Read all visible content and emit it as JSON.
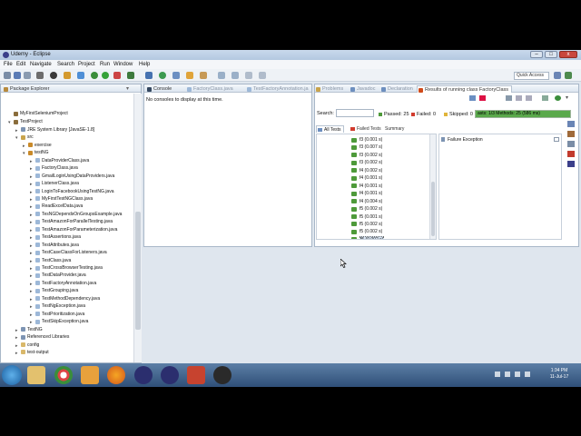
{
  "window": {
    "title": "Udemy - Eclipse",
    "minimize": "–",
    "maximize": "□",
    "close": "x"
  },
  "menu": [
    "File",
    "Edit",
    "Navigate",
    "Search",
    "Project",
    "Run",
    "Window",
    "Help"
  ],
  "quick_access": {
    "placeholder": "Quick Access"
  },
  "package_explorer": {
    "tab": "Package Explorer",
    "items": [
      {
        "label": "MyFirstSeleniumProject",
        "level": 0,
        "icon": "project-icon",
        "expand": ""
      },
      {
        "label": "TestProject",
        "level": 0,
        "icon": "project-icon",
        "expand": "▾"
      },
      {
        "label": "JRE System Library [JavaSE-1.8]",
        "level": 1,
        "icon": "library-icon",
        "expand": "▸"
      },
      {
        "label": "src",
        "level": 1,
        "icon": "source-folder-icon",
        "expand": "▾"
      },
      {
        "label": "exercise",
        "level": 2,
        "icon": "package-icon",
        "expand": "▸"
      },
      {
        "label": "testNG",
        "level": 2,
        "icon": "package-icon",
        "expand": "▾"
      },
      {
        "label": "DataProviderClass.java",
        "level": 3,
        "icon": "java-file-icon",
        "expand": "▸"
      },
      {
        "label": "FactoryClass.java",
        "level": 3,
        "icon": "java-file-icon",
        "expand": "▸"
      },
      {
        "label": "GmailLoginUsingDataProviders.java",
        "level": 3,
        "icon": "java-file-icon",
        "expand": "▸"
      },
      {
        "label": "ListenerClass.java",
        "level": 3,
        "icon": "java-file-icon",
        "expand": "▸"
      },
      {
        "label": "LoginToFacebookUsingTestNG.java",
        "level": 3,
        "icon": "java-file-icon",
        "expand": "▸"
      },
      {
        "label": "MyFirstTestNGClass.java",
        "level": 3,
        "icon": "java-file-icon",
        "expand": "▸"
      },
      {
        "label": "ReadExcelData.java",
        "level": 3,
        "icon": "java-file-icon",
        "expand": "▸"
      },
      {
        "label": "TesNGDependsOnGroupsExample.java",
        "level": 3,
        "icon": "java-file-icon",
        "expand": "▸"
      },
      {
        "label": "TestAmazonForParallelTesting.java",
        "level": 3,
        "icon": "java-file-icon",
        "expand": "▸"
      },
      {
        "label": "TestAmazonForParameterization.java",
        "level": 3,
        "icon": "java-file-icon",
        "expand": "▸"
      },
      {
        "label": "TestAssertions.java",
        "level": 3,
        "icon": "java-file-icon",
        "expand": "▸"
      },
      {
        "label": "TestAttributes.java",
        "level": 3,
        "icon": "java-file-icon",
        "expand": "▸"
      },
      {
        "label": "TestCaseClassForListeners.java",
        "level": 3,
        "icon": "java-file-icon",
        "expand": "▸"
      },
      {
        "label": "TestClass.java",
        "level": 3,
        "icon": "java-file-icon",
        "expand": "▸"
      },
      {
        "label": "TestCrossBrowserTesting.java",
        "level": 3,
        "icon": "java-file-icon",
        "expand": "▸"
      },
      {
        "label": "TestDataProvider.java",
        "level": 3,
        "icon": "java-file-icon",
        "expand": "▸"
      },
      {
        "label": "TestFactoryAnnotation.java",
        "level": 3,
        "icon": "java-file-icon",
        "expand": "▸"
      },
      {
        "label": "TestGrouping.java",
        "level": 3,
        "icon": "java-file-icon",
        "expand": "▸"
      },
      {
        "label": "TestMethodDependency.java",
        "level": 3,
        "icon": "java-file-icon",
        "expand": "▸"
      },
      {
        "label": "TestNgException.java",
        "level": 3,
        "icon": "java-file-icon",
        "expand": "▸"
      },
      {
        "label": "TestPrioritization.java",
        "level": 3,
        "icon": "java-file-icon",
        "expand": "▸"
      },
      {
        "label": "TestSkipException.java",
        "level": 3,
        "icon": "java-file-icon",
        "expand": "▸"
      },
      {
        "label": "TestNG",
        "level": 1,
        "icon": "library-icon",
        "expand": "▸"
      },
      {
        "label": "Referenced Libraries",
        "level": 1,
        "icon": "library-icon",
        "expand": "▸"
      },
      {
        "label": "config",
        "level": 1,
        "icon": "folder-icon",
        "expand": "▸"
      },
      {
        "label": "test-output",
        "level": 1,
        "icon": "folder-icon",
        "expand": "▸"
      }
    ]
  },
  "editor_tabs": [
    {
      "label": "Console",
      "active": true
    },
    {
      "label": "FactoryClass.java",
      "active": false
    },
    {
      "label": "TestFactoryAnnotation.ja",
      "active": false
    }
  ],
  "console": {
    "message": "No consoles to display at this time."
  },
  "results_tabs": [
    {
      "label": "Problems",
      "active": false
    },
    {
      "label": "Javadoc",
      "active": false
    },
    {
      "label": "Declaration",
      "active": false
    },
    {
      "label": "Results of running class FactoryClass",
      "active": true
    }
  ],
  "results": {
    "search_label": "Search:",
    "passed": "Passed: 25",
    "failed": "Failed: 0",
    "skipped": "Skipped: 0",
    "progress_text": "asts: 1/3   Methods: 25 (586 ms)",
    "progress_fraction": 1.0,
    "subtabs": [
      "All Tests",
      "Failed Tests",
      "Summary"
    ],
    "failure_header": "Failure Exception",
    "tests": [
      "f3 (0.001 s)",
      "f3 (0.007 s)",
      "f3 (0.002 s)",
      "f3 (0.002 s)",
      "f4 (0.002 s)",
      "f4 (0.001 s)",
      "f4 (0.001 s)",
      "f4 (0.001 s)",
      "f4 (0.004 s)",
      "f5 (0.002 s)",
      "f5 (0.001 s)",
      "f5 (0.002 s)",
      "f5 (0.002 s)",
      "f5 (0.002 s)"
    ]
  },
  "clock": {
    "time": "1:34 PM",
    "date": "11-Jul-17"
  },
  "colors": {
    "pass": "#4e9a3a",
    "fail": "#d23b2e",
    "skip": "#e0b43a",
    "progress": "#5aa94b"
  }
}
